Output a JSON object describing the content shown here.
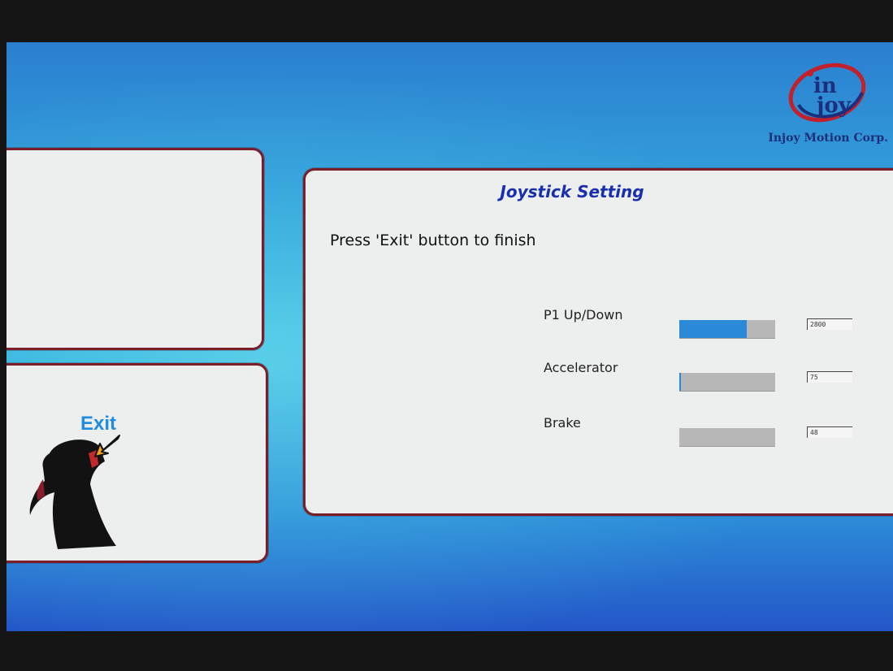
{
  "brand": {
    "logo_text": "in joy",
    "name": "Injoy Motion Corp."
  },
  "joystick_panel": {
    "title": "Joystick Setting",
    "instruction": "Press 'Exit' button to finish",
    "rows": [
      {
        "label": "P1 Up/Down",
        "value": "2800",
        "level": 0.7
      },
      {
        "label": "Accelerator",
        "value": "75",
        "level": 0.02
      },
      {
        "label": "Brake",
        "value": "48",
        "level": 0.0
      }
    ]
  },
  "exit_panel": {
    "label": "Exit",
    "icons": [
      "joystick-icon",
      "arrow-pointer-icon"
    ]
  },
  "colors": {
    "panel_border": "#7a1f2a",
    "title_blue": "#1a2fb0",
    "bar_fill": "#2a8ad8",
    "exit_blue": "#1f8ce0"
  }
}
